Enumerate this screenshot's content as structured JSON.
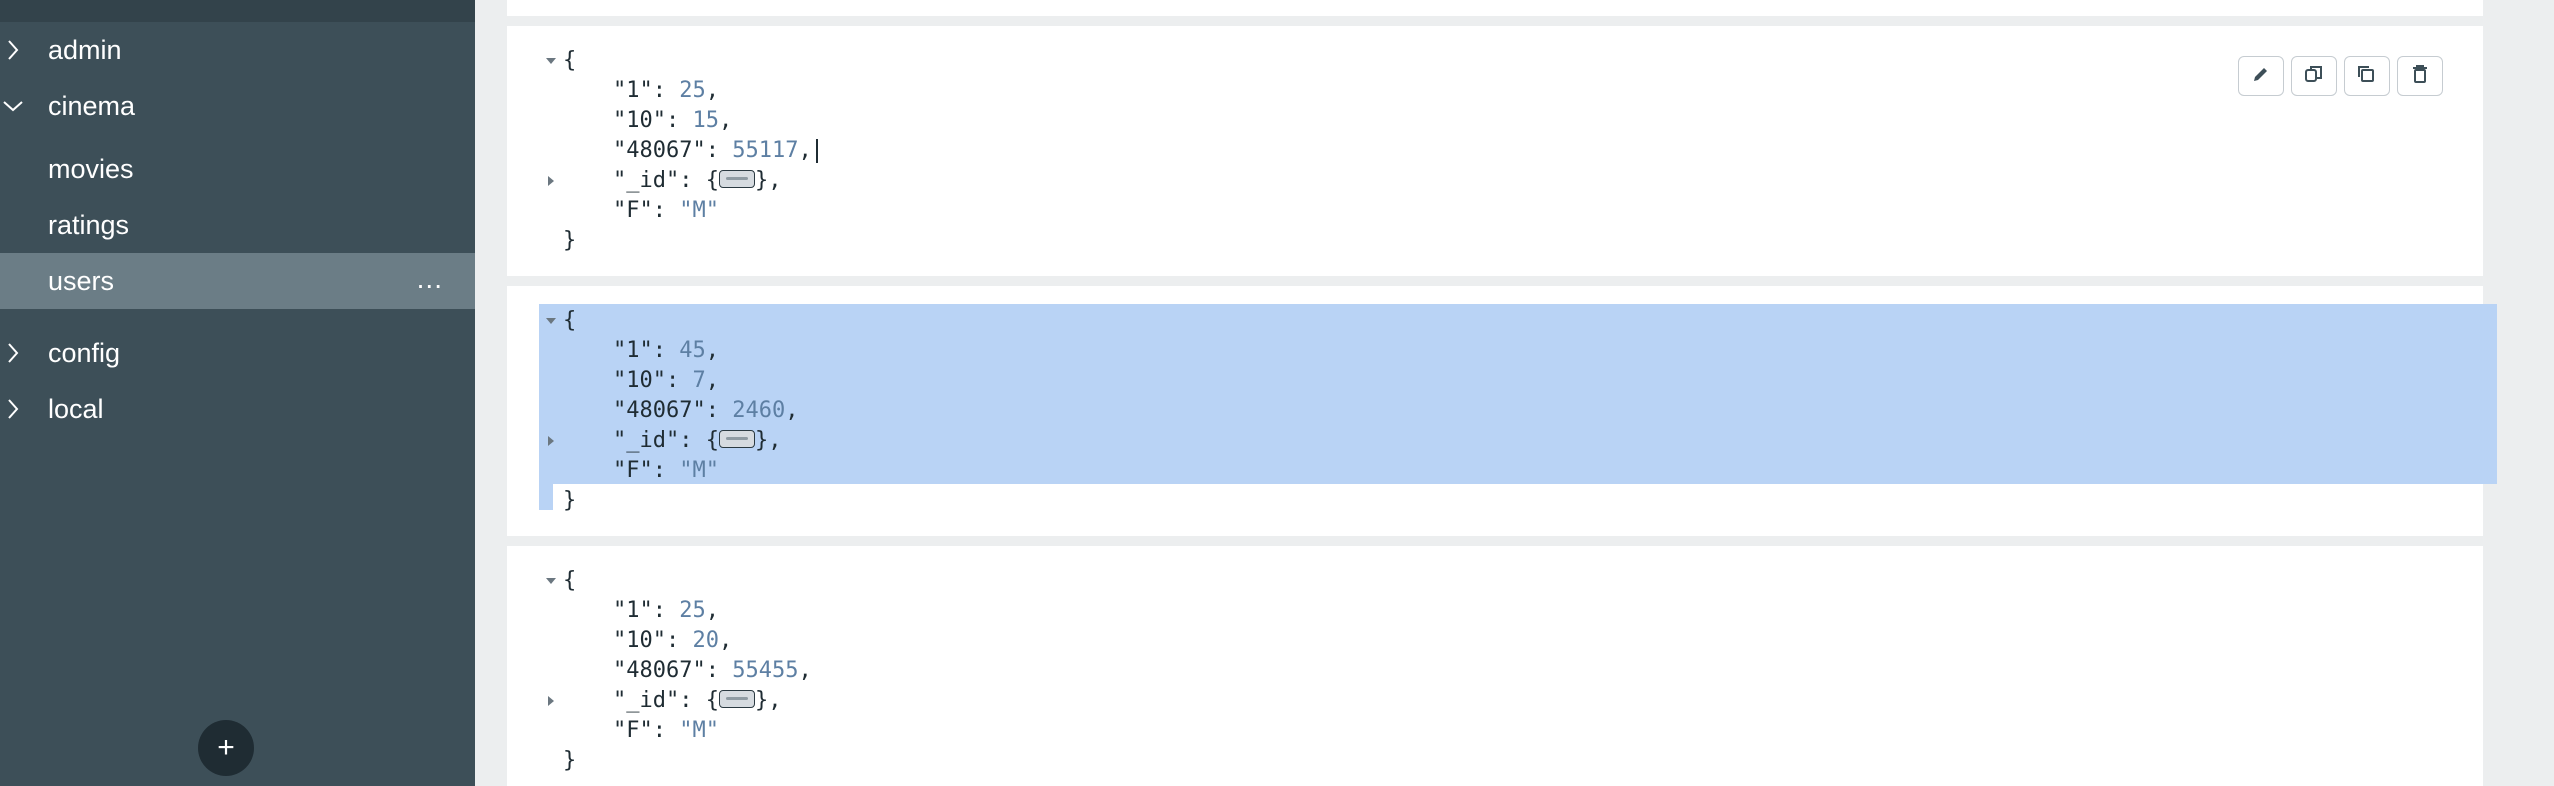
{
  "sidebar": {
    "databases": [
      {
        "name": "admin",
        "expanded": false
      },
      {
        "name": "cinema",
        "expanded": true,
        "collections": [
          "movies",
          "ratings",
          "users"
        ]
      },
      {
        "name": "config",
        "expanded": false
      },
      {
        "name": "local",
        "expanded": false
      }
    ],
    "active_collection": "users",
    "active_more": "...",
    "add_button": "+"
  },
  "documents": [
    {
      "f1": "25",
      "f10": "15",
      "f48067": "55117",
      "id_collapsed": true,
      "F": "\"M\""
    },
    {
      "f1": "45",
      "f10": "7",
      "f48067": "2460",
      "id_collapsed": true,
      "F": "\"M\""
    },
    {
      "f1": "25",
      "f10": "20",
      "f48067": "55455",
      "id_collapsed": true,
      "F": "\"M\""
    }
  ],
  "keys": {
    "k1": "\"1\"",
    "k10": "\"10\"",
    "k48067": "\"48067\"",
    "kid": "\"_id\"",
    "kF": "\"F\""
  },
  "doc_actions": [
    "edit-icon",
    "copy-icon",
    "clone-icon",
    "delete-icon"
  ],
  "colors": {
    "sidebar": "#3d4f58",
    "selection": "#b9d3f5",
    "value": "#5d7fa3"
  }
}
